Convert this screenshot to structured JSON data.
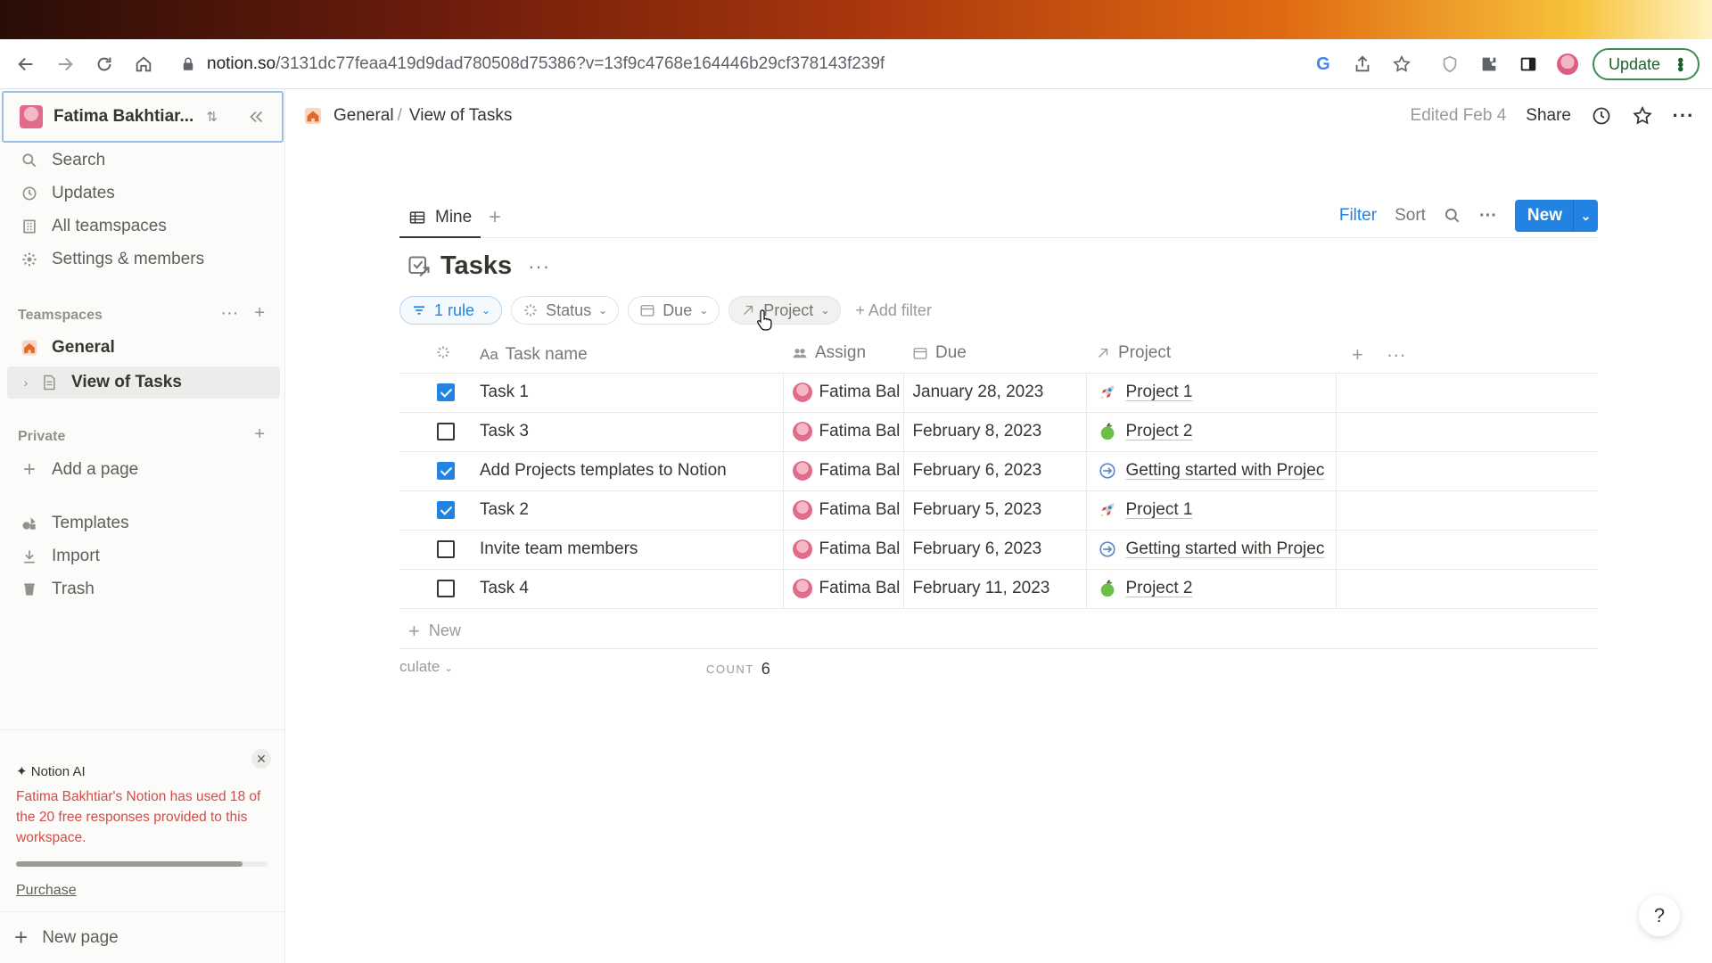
{
  "browser": {
    "url_host": "notion.so",
    "url_path": "/3131dc77feaa419d9dad780508d75386?v=13f9c4768e164446b29cf378143f239f",
    "update_label": "Update"
  },
  "sidebar": {
    "workspace_name": "Fatima Bakhtiar...",
    "nav": [
      {
        "label": "Search"
      },
      {
        "label": "Updates"
      },
      {
        "label": "All teamspaces"
      },
      {
        "label": "Settings & members"
      }
    ],
    "teamspaces_label": "Teamspaces",
    "teamspace_items": [
      {
        "label": "General"
      },
      {
        "label": "View of Tasks"
      }
    ],
    "private_label": "Private",
    "add_page_label": "Add a page",
    "tools": [
      {
        "label": "Templates"
      },
      {
        "label": "Import"
      },
      {
        "label": "Trash"
      }
    ],
    "ai": {
      "title": "Notion AI",
      "message": "Fatima Bakhtiar's Notion has used 18 of the 20 free responses provided to this workspace.",
      "used": 18,
      "total": 20,
      "purchase_label": "Purchase"
    },
    "new_page_label": "New page"
  },
  "topbar": {
    "breadcrumb": [
      "General",
      "View of Tasks"
    ],
    "separator": "/",
    "edited": "Edited Feb 4",
    "share": "Share"
  },
  "database": {
    "view_tab": "Mine",
    "actions": {
      "filter": "Filter",
      "sort": "Sort",
      "new": "New"
    },
    "title": "Tasks",
    "filters": {
      "rule": "1 rule",
      "status": "Status",
      "due": "Due",
      "project": "Project",
      "add_filter": "Add filter"
    },
    "columns": {
      "task_name": "Task name",
      "assign": "Assign",
      "due": "Due",
      "project": "Project",
      "name_prefix": "Aa"
    },
    "rows": [
      {
        "done": true,
        "name": "Task 1",
        "assign": "Fatima Bal",
        "due": "January 28, 2023",
        "project": "Project 1",
        "project_icon": "rocket"
      },
      {
        "done": false,
        "name": "Task 3",
        "assign": "Fatima Bal",
        "due": "February 8, 2023",
        "project": "Project 2",
        "project_icon": "green-apple"
      },
      {
        "done": true,
        "name": "Add Projects templates to Notion",
        "assign": "Fatima Bal",
        "due": "February 6, 2023",
        "project": "Getting started with Projec",
        "project_icon": "arrow-circle"
      },
      {
        "done": true,
        "name": "Task 2",
        "assign": "Fatima Bal",
        "due": "February 5, 2023",
        "project": "Project 1",
        "project_icon": "rocket"
      },
      {
        "done": false,
        "name": "Invite team members",
        "assign": "Fatima Bal",
        "due": "February 6, 2023",
        "project": "Getting started with Projec",
        "project_icon": "arrow-circle"
      },
      {
        "done": false,
        "name": "Task 4",
        "assign": "Fatima Bal",
        "due": "February 11, 2023",
        "project": "Project 2",
        "project_icon": "green-apple"
      }
    ],
    "new_row_label": "New",
    "calculate_label": "culate",
    "count_label": "COUNT",
    "count_value": "6"
  },
  "help_label": "?",
  "colors": {
    "accent": "#2383e2",
    "ai_text": "#d44c47",
    "text": "#37352f"
  }
}
